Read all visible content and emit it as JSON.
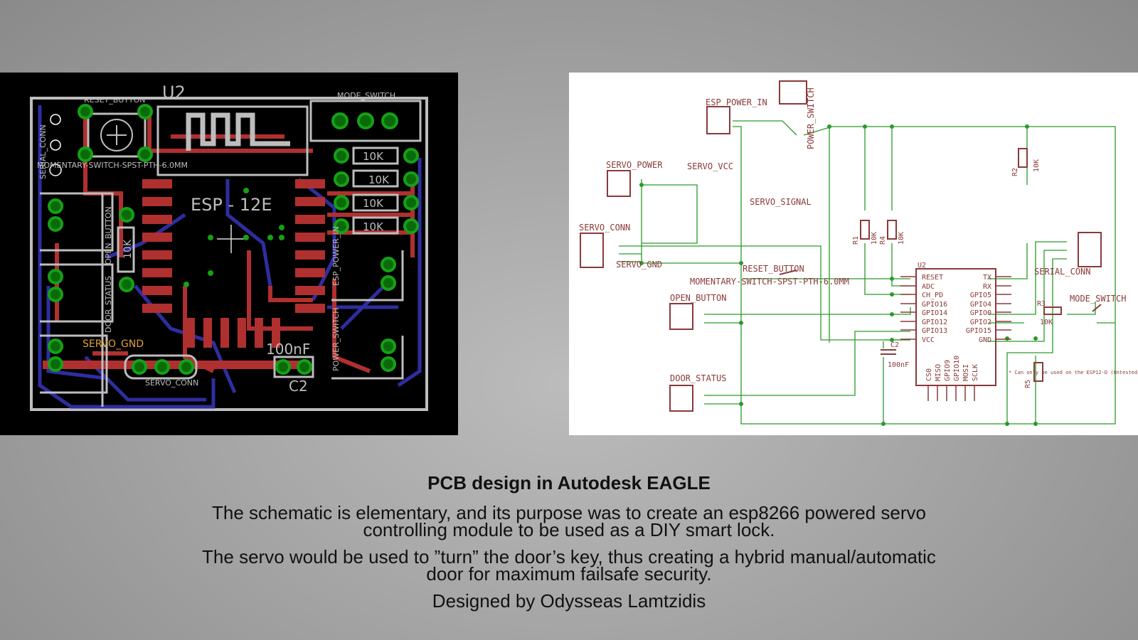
{
  "pcb": {
    "labels": {
      "u2": "U2",
      "reset_button": "RESET_BUTTON",
      "mode_switch": "MODE_SWITCH",
      "serial_conn": "SERIAL_CONN",
      "momentary": "MOMENTARY-SWITCH-SPST-PTH-6.0MM",
      "esp": "ESP - 12E",
      "r10k_1": "10K",
      "r10k_2": "10K",
      "r10k_3": "10K",
      "r10k_4": "10K",
      "r10k_5": "10K",
      "servo_gnd": "SERVO_GND",
      "cap": "100nF",
      "c2": "C2",
      "servo_conn": "SERVO_CONN",
      "esp_power_in": "ESP_POWER_IN",
      "power_switch": "POWER_SWITCH",
      "door_status": "DOOR_STATUS",
      "open_button": "OPEN_BUTTON"
    }
  },
  "schematic": {
    "labels": {
      "esp_power_in": "ESP_POWER_IN",
      "power_switch": "POWER_SWITCH",
      "servo_power": "SERVO_POWER",
      "servo_vcc": "SERVO_VCC",
      "servo_signal": "SERVO_SIGNAL",
      "servo_conn": "SERVO_CONN",
      "servo_gnd": "SERVO_GND",
      "reset_button": "RESET_BUTTON",
      "momentary": "MOMENTARY-SWITCH-SPST-PTH-6.0MM",
      "open_button": "OPEN_BUTTON",
      "door_status": "DOOR_STATUS",
      "serial_conn": "SERIAL_CONN",
      "mode_switch": "MODE_SWITCH",
      "u2": "U2",
      "r1": "R1",
      "r4": "R4",
      "r2": "R2",
      "r3": "R3",
      "r5": "R5",
      "r10k": "10K",
      "c2": "C2",
      "cap": "100nF",
      "note": "* Can only be used on the ESP12-D (Untested, info from esp8266 wiki)"
    },
    "chip_left_pins": [
      "RESET",
      "ADC",
      "CH_PD",
      "GPIO16",
      "GPIO14",
      "GPIO12",
      "GPIO13",
      "VCC"
    ],
    "chip_right_pins": [
      "TX",
      "RX",
      "GPIO5",
      "GPIO4",
      "GPIO0",
      "GPIO2",
      "GPIO15",
      "GND"
    ],
    "chip_bottom_pins": [
      "CS0",
      "MISO",
      "GPIO9",
      "GPIO10",
      "MOSI",
      "SCLK"
    ]
  },
  "caption": {
    "title": "PCB design in Autodesk EAGLE",
    "line1a": "The schematic is elementary, and its purpose was to create an esp8266 powered servo",
    "line1b": "controlling module to be used as a DIY smart lock.",
    "line2a": "The servo would be used to ”turn” the door’s key, thus creating a hybrid manual/automatic",
    "line2b": "door for maximum failsafe security.",
    "credit": "Designed by Odysseas Lamtzidis"
  }
}
